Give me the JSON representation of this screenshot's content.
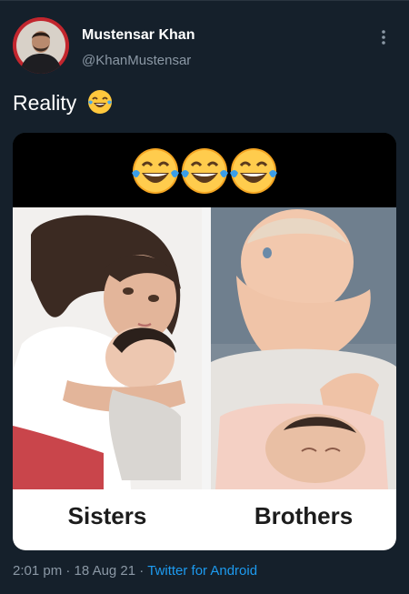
{
  "author": {
    "display_name": "Mustensar Khan",
    "handle": "@KhanMustensar",
    "avatar_icon": "avatar-photo"
  },
  "menu": {
    "icon": "more-vertical-icon"
  },
  "tweet": {
    "text": "Reality",
    "emoji": "tears-of-joy-emoji"
  },
  "media": {
    "emoji_count": 3,
    "emoji": "tears-of-joy-emoji",
    "left_caption": "Sisters",
    "right_caption": "Brothers"
  },
  "meta": {
    "time": "2:01 pm",
    "separator": " · ",
    "date": "18 Aug 21",
    "separator2": " · ",
    "source": "Twitter for Android"
  },
  "colors": {
    "background": "#15202b",
    "link": "#1d9bf0",
    "secondary_text": "#8b98a5",
    "avatar_ring": "#c2262e"
  }
}
